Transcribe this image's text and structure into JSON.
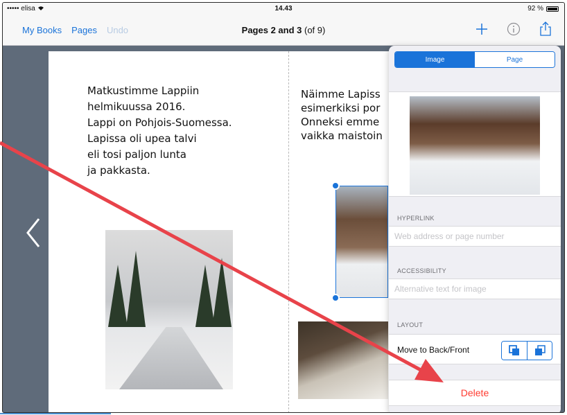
{
  "status_bar": {
    "carrier": "••••• elisa",
    "time": "14.43",
    "battery": "92 %"
  },
  "nav_bar": {
    "my_books": "My Books",
    "pages": "Pages",
    "undo": "Undo",
    "title_bold": "Pages 2 and 3",
    "title_rest": " (of 9)",
    "icons": [
      "plus-icon",
      "info-icon",
      "share-icon"
    ]
  },
  "book": {
    "left_text": "Matkustimme Lappiin\nhelmikuussa 2016.\nLappi on Pohjois-Suomessa.\nLapissa oli upea talvi\neli tosi paljon lunta\nja pakkasta.",
    "right_text": "Näimme Lapiss\nesimerkiksi por\nOnneksi emme\nvaikka maistoin"
  },
  "popover": {
    "tabs": [
      {
        "label": "Image",
        "active": true
      },
      {
        "label": "Page",
        "active": false
      }
    ],
    "hyperlink": {
      "label": "HYPERLINK",
      "placeholder": "Web address or page number"
    },
    "accessibility": {
      "label": "ACCESSIBILITY",
      "placeholder": "Alternative text for image"
    },
    "layout": {
      "label": "LAYOUT",
      "move_label": "Move to Back/Front"
    },
    "delete_label": "Delete"
  },
  "colors": {
    "accent": "#1a73d9",
    "delete": "#ff3b30",
    "annotation_arrow": "#e8434a"
  }
}
